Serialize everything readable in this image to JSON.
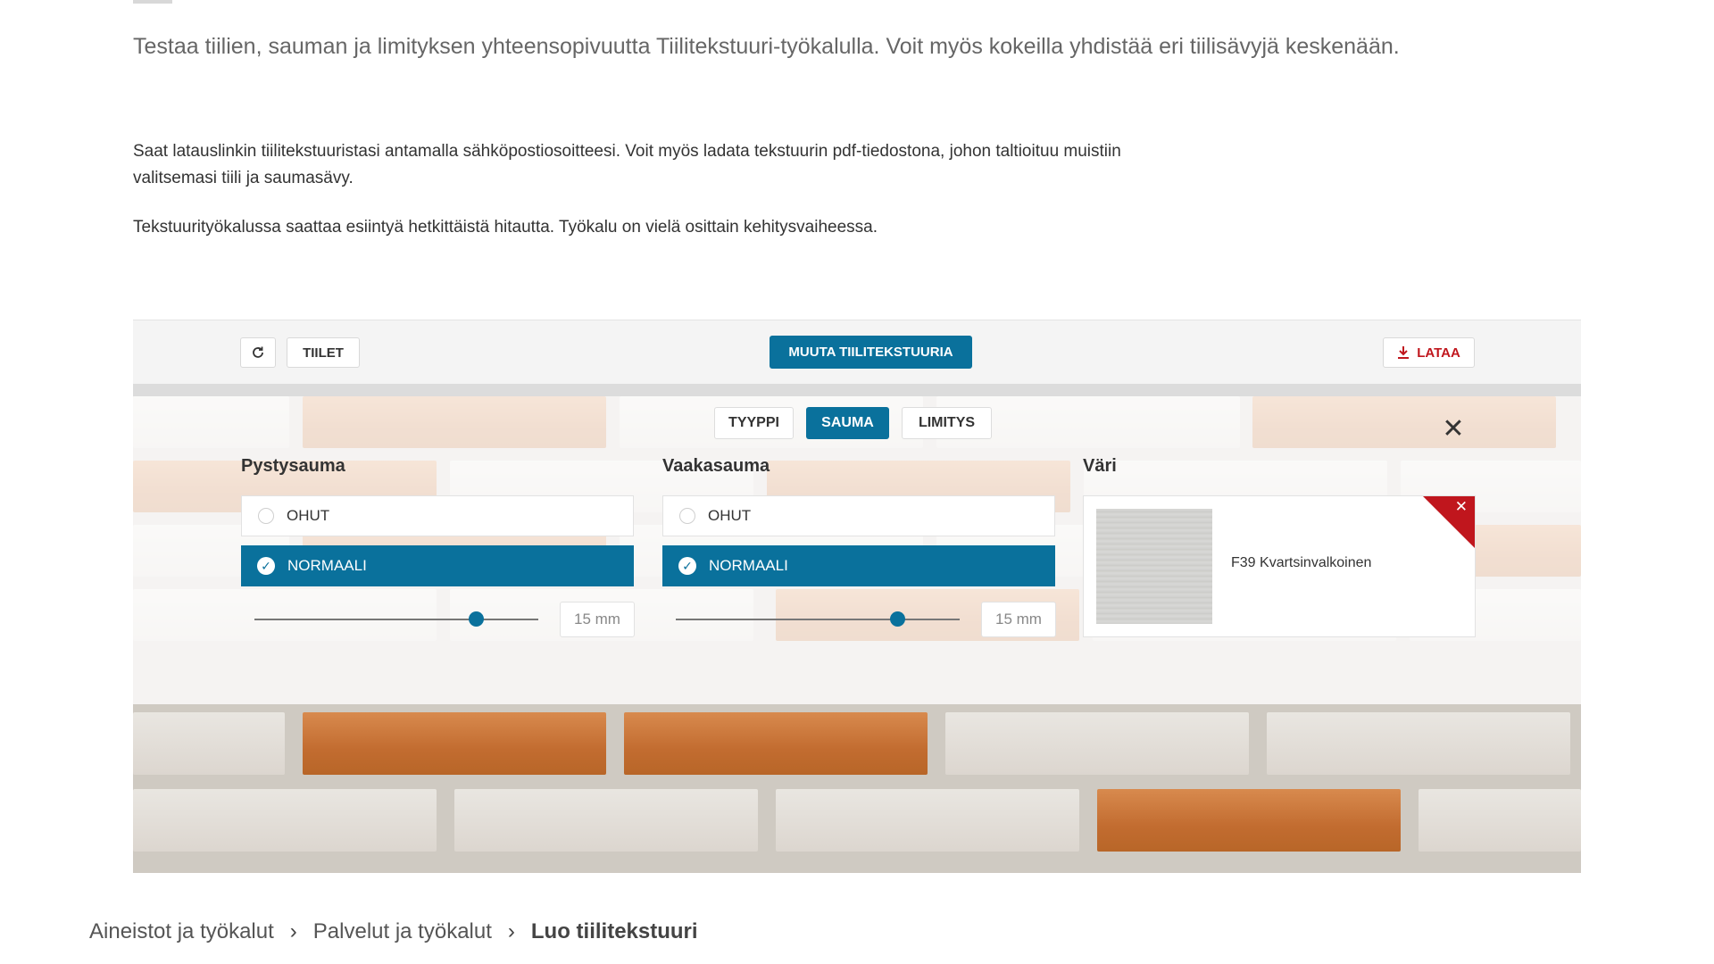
{
  "intro": "Testaa tiilien, sauman ja limityksen yhteensopivuutta Tiilitekstuuri-työkalulla. Voit myös kokeilla yhdistää eri tiilisävyjä keskenään.",
  "paragraphs": {
    "p1": "Saat latauslinkin tiilitekstuuristasi antamalla sähköpostiosoitteesi. Voit myös ladata tekstuurin pdf-tiedostona, johon taltioituu muistiin valitsemasi tiili ja saumasävy.",
    "p2": "Tekstuurityökalussa saattaa esiintyä hetkittäistä hitautta. Työkalu on vielä osittain kehitysvaiheessa."
  },
  "toolbar": {
    "tiilet": "TIILET",
    "muuta": "MUUTA TIILITEKSTUURIA",
    "lataa": "LATAA"
  },
  "tabs": {
    "tyyppi": "TYYPPI",
    "sauma": "SAUMA",
    "limitys": "LIMITYS",
    "active": "SAUMA"
  },
  "pystysauma": {
    "title": "Pystysauma",
    "options": [
      "OHUT",
      "NORMAALI"
    ],
    "selected": "NORMAALI",
    "value": "15 mm",
    "slider_fraction": 0.78
  },
  "vaakasauma": {
    "title": "Vaakasauma",
    "options": [
      "OHUT",
      "NORMAALI"
    ],
    "selected": "NORMAALI",
    "value": "15 mm",
    "slider_fraction": 0.78
  },
  "vari": {
    "title": "Väri",
    "color_name": "F39 Kvartsinvalkoinen"
  },
  "breadcrumb": {
    "items": [
      "Aineistot ja työkalut",
      "Palvelut ja työkalut"
    ],
    "current": "Luo tiilitekstuuri"
  },
  "colors": {
    "primary": "#0a719c",
    "danger": "#c0161d"
  }
}
